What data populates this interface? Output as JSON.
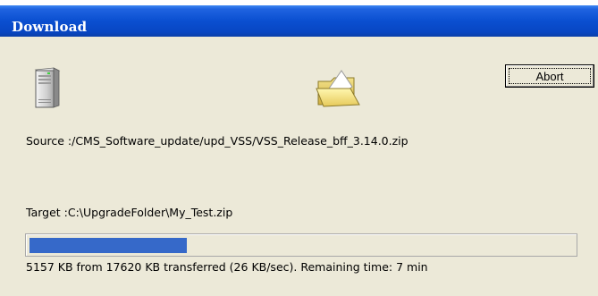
{
  "window": {
    "title": "Download"
  },
  "icons": {
    "source": "server-icon",
    "destination": "folder-icon"
  },
  "buttons": {
    "abort_label": "Abort"
  },
  "transfer": {
    "source_text": "Source :/CMS_Software_update/upd_VSS/VSS_Release_bff_3.14.0.zip",
    "target_text": "Target :C:\\UpgradeFolder\\My_Test.zip",
    "status_text": "5157 KB from 17620 KB transferred (26 KB/sec). Remaining time: 7 min",
    "progress_fraction": 0.29
  },
  "colors": {
    "titlebar": "#0a4fd0",
    "dialog_background": "#ece9d8",
    "progress_fill": "#3669c9"
  }
}
